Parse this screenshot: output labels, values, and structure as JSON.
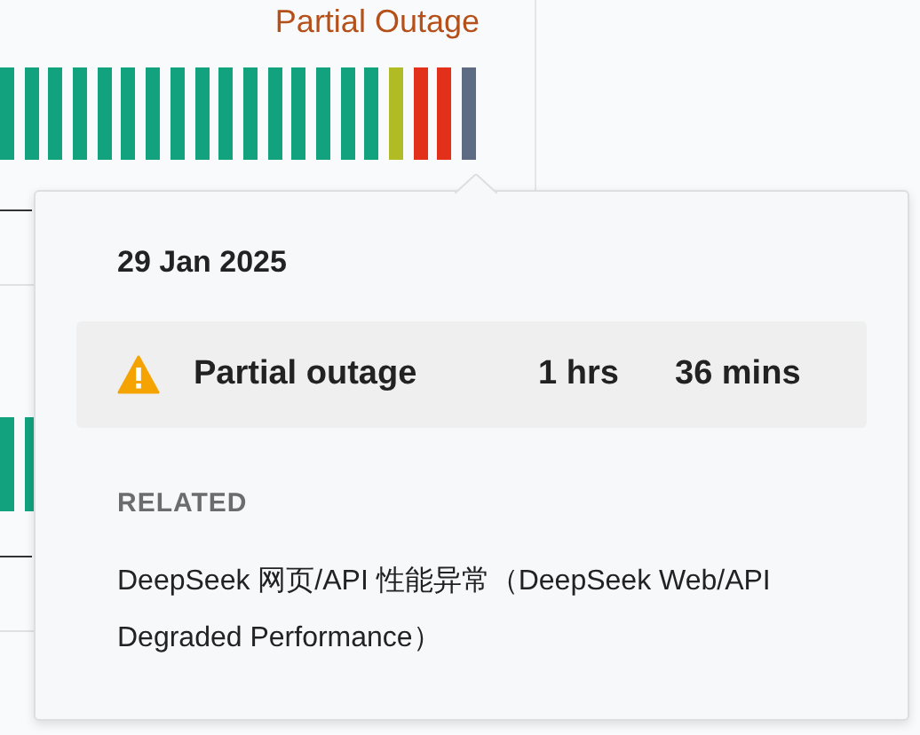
{
  "component": {
    "status": "Partial Outage",
    "days": [
      {
        "color": "#12a37e"
      },
      {
        "color": "#12a37e"
      },
      {
        "color": "#12a37e"
      },
      {
        "color": "#12a37e"
      },
      {
        "color": "#12a37e"
      },
      {
        "color": "#12a37e"
      },
      {
        "color": "#12a37e"
      },
      {
        "color": "#12a37e"
      },
      {
        "color": "#12a37e"
      },
      {
        "color": "#12a37e"
      },
      {
        "color": "#12a37e"
      },
      {
        "color": "#12a37e"
      },
      {
        "color": "#12a37e"
      },
      {
        "color": "#12a37e"
      },
      {
        "color": "#12a37e"
      },
      {
        "color": "#12a37e"
      },
      {
        "color": "#b1bb23"
      },
      {
        "color": "#e2301a"
      },
      {
        "color": "#e2301a"
      },
      {
        "color": "#5d6b85"
      }
    ]
  },
  "next_component": {
    "days": [
      {
        "color": "#12a37e"
      },
      {
        "color": "#12a37e"
      }
    ]
  },
  "tooltip": {
    "date": "29 Jan 2025",
    "incident": {
      "kind": "warning",
      "label": "Partial outage",
      "hours": "1 hrs",
      "minutes": "36 mins"
    },
    "related_heading": "RELATED",
    "related": [
      "DeepSeek 网页/API 性能异常（DeepSeek Web/API Degraded Performance）"
    ]
  }
}
